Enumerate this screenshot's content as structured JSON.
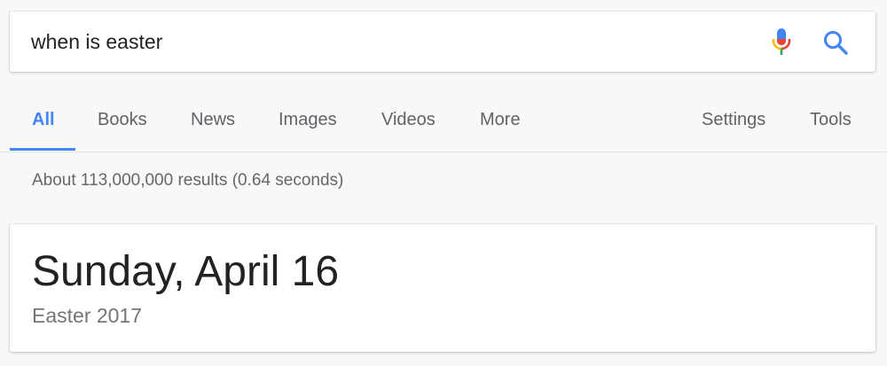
{
  "search": {
    "query": "when is easter",
    "mic_icon": "microphone-icon",
    "search_icon": "magnifier-icon"
  },
  "tabs": {
    "items": [
      {
        "label": "All",
        "active": true
      },
      {
        "label": "Books",
        "active": false
      },
      {
        "label": "News",
        "active": false
      },
      {
        "label": "Images",
        "active": false
      },
      {
        "label": "Videos",
        "active": false
      },
      {
        "label": "More",
        "active": false
      }
    ],
    "settings_label": "Settings",
    "tools_label": "Tools"
  },
  "result_stats": "About 113,000,000 results (0.64 seconds)",
  "answer": {
    "main": "Sunday, April 16",
    "sub": "Easter 2017"
  },
  "colors": {
    "accent": "#4285f4",
    "mic_blue": "#4285f4",
    "mic_red": "#ea4335",
    "mic_yellow": "#fbbc05",
    "mic_green": "#34a853",
    "page_bg": "#f8f8f8",
    "card_bg": "#ffffff"
  }
}
